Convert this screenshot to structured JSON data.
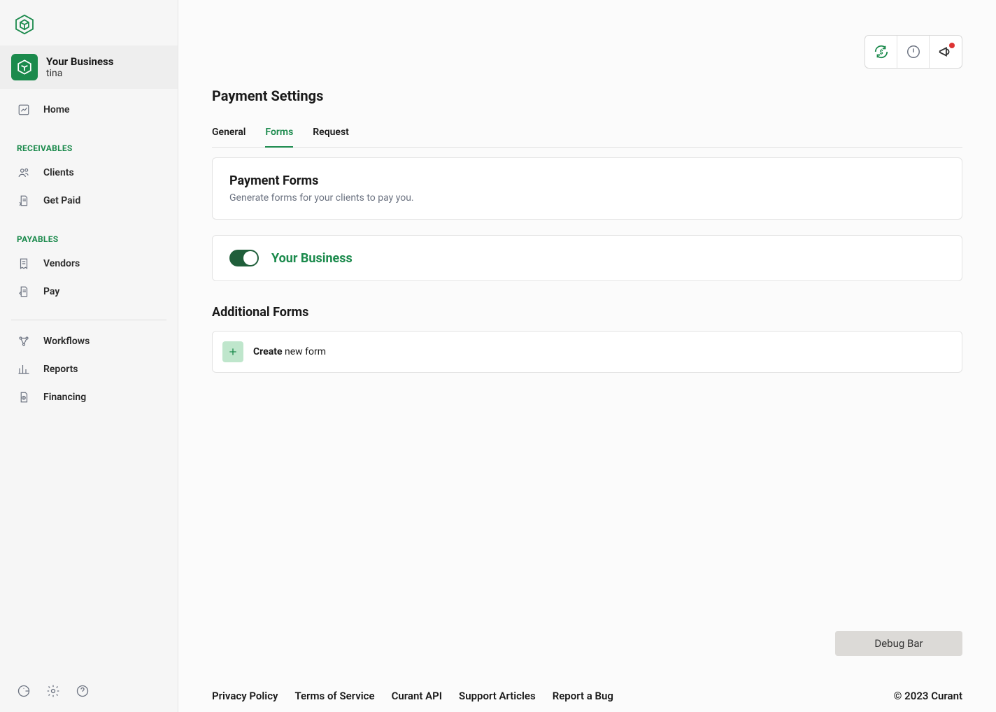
{
  "sidebar": {
    "business_name": "Your Business",
    "business_user": "tina",
    "nav_home": "Home",
    "section_receivables": "RECEIVABLES",
    "nav_clients": "Clients",
    "nav_get_paid": "Get Paid",
    "section_payables": "PAYABLES",
    "nav_vendors": "Vendors",
    "nav_pay": "Pay",
    "nav_workflows": "Workflows",
    "nav_reports": "Reports",
    "nav_financing": "Financing"
  },
  "topbar": {
    "has_notification": true
  },
  "page": {
    "title": "Payment Settings",
    "tabs": {
      "general": "General",
      "forms": "Forms",
      "request": "Request",
      "active": "forms"
    }
  },
  "forms_card": {
    "title": "Payment Forms",
    "subtitle": "Generate forms for your clients to pay you."
  },
  "default_form": {
    "enabled": true,
    "label": "Your Business"
  },
  "additional": {
    "title": "Additional Forms",
    "create_bold": "Create",
    "create_rest": " new form"
  },
  "debug_bar": "Debug Bar",
  "footer": {
    "links": {
      "privacy": "Privacy Policy",
      "terms": "Terms of Service",
      "api": "Curant API",
      "support": "Support Articles",
      "bug": "Report a Bug"
    },
    "copyright": "© 2023 Curant"
  },
  "colors": {
    "brand_green": "#1b8a4c"
  }
}
